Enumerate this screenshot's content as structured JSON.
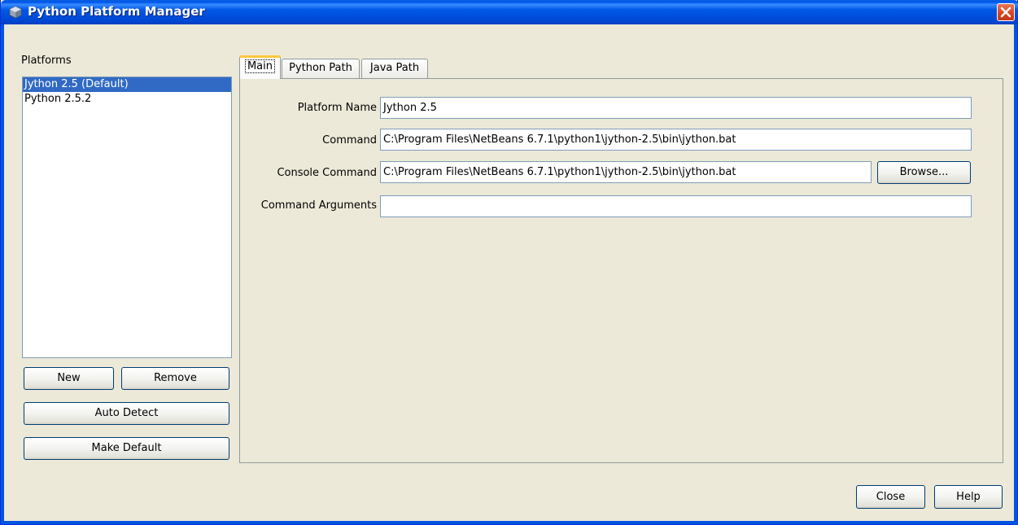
{
  "window": {
    "title": "Python Platform Manager",
    "icon": "python-platform-icon",
    "close_icon": "close-icon"
  },
  "sidebar": {
    "label": "Platforms",
    "items": [
      {
        "label": "Jython 2.5 (Default)",
        "selected": true
      },
      {
        "label": "Python 2.5.2",
        "selected": false
      }
    ],
    "buttons": {
      "new": "New",
      "remove": "Remove",
      "auto_detect": "Auto Detect",
      "make_default": "Make Default"
    }
  },
  "tabs": [
    {
      "label": "Main",
      "active": true
    },
    {
      "label": "Python Path",
      "active": false
    },
    {
      "label": "Java Path",
      "active": false
    }
  ],
  "main": {
    "platform_name": {
      "label": "Platform Name",
      "value": "Jython 2.5"
    },
    "command": {
      "label": "Command",
      "value": "C:\\Program Files\\NetBeans 6.7.1\\python1\\jython-2.5\\bin\\jython.bat"
    },
    "console_command": {
      "label": "Console Command",
      "value": "C:\\Program Files\\NetBeans 6.7.1\\python1\\jython-2.5\\bin\\jython.bat"
    },
    "command_arguments": {
      "label": "Command Arguments",
      "value": ""
    },
    "browse_label": "Browse..."
  },
  "footer": {
    "close_label": "Close",
    "help_label": "Help"
  },
  "colors": {
    "titlebar": "#0054e3",
    "selection": "#316ac5",
    "dialog_bg": "#ece9d8",
    "active_tab_accent": "#ffc83c"
  }
}
